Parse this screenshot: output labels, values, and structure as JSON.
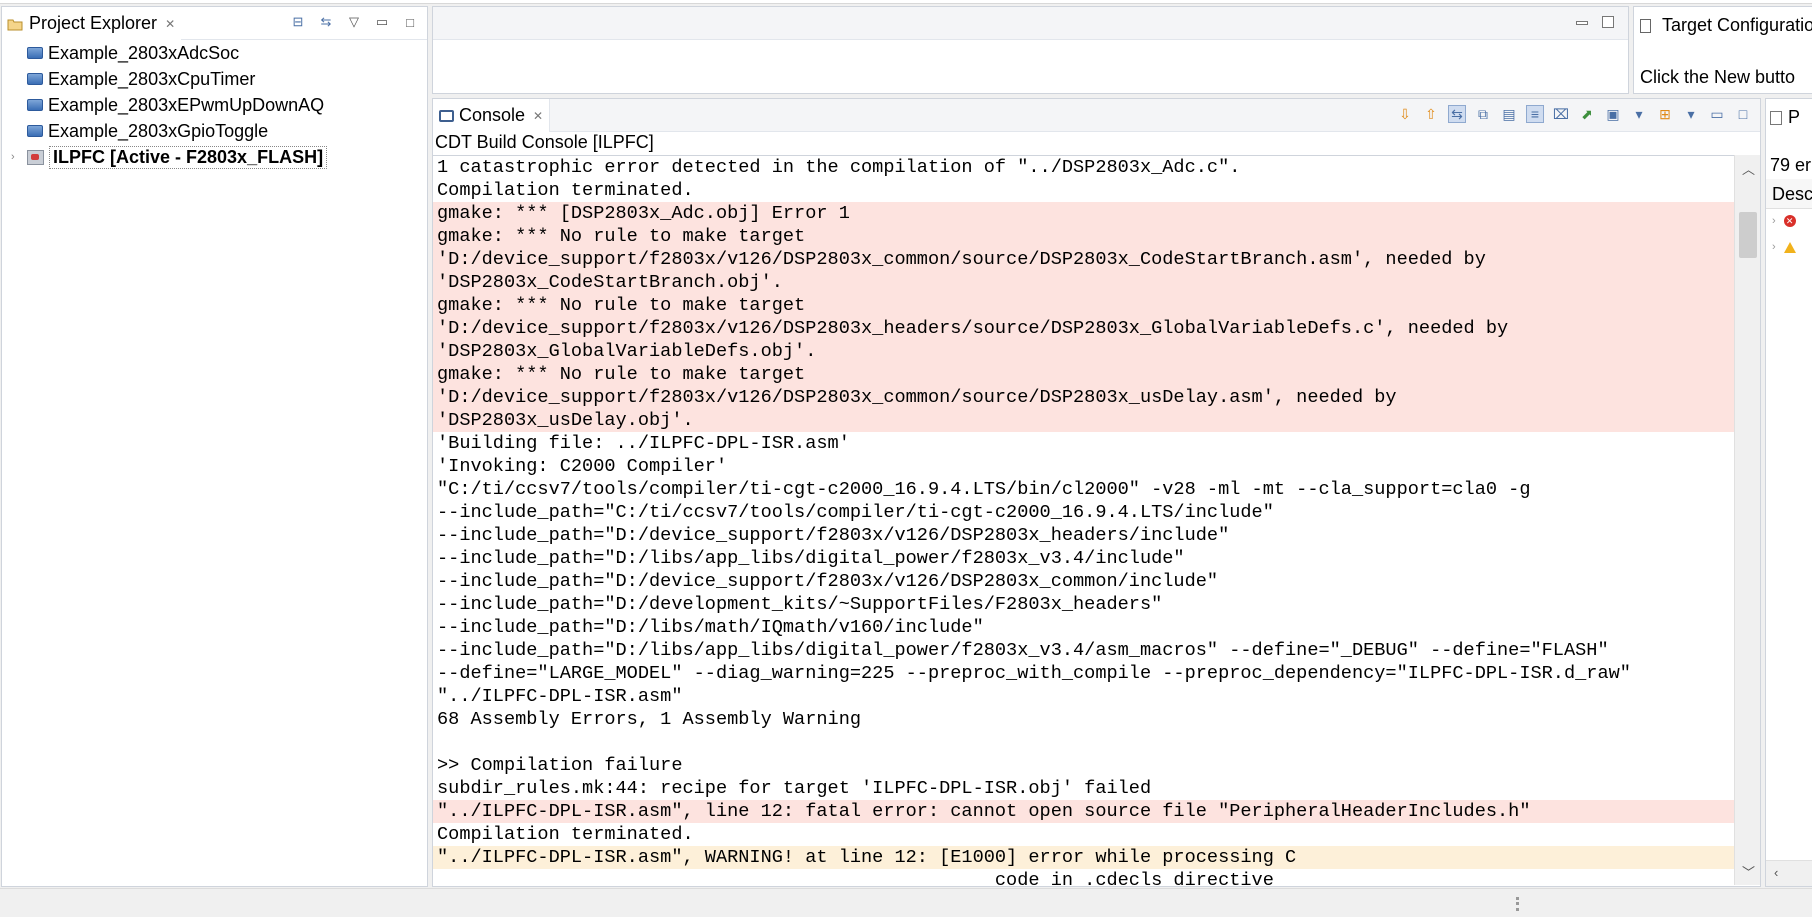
{
  "project_explorer": {
    "title": "Project Explorer",
    "items": [
      {
        "label": "Example_2803xAdcSoc"
      },
      {
        "label": "Example_2803xCpuTimer"
      },
      {
        "label": "Example_2803xEPwmUpDownAQ"
      },
      {
        "label": "Example_2803xGpioToggle"
      },
      {
        "label": "ILPFC  [Active - F2803x_FLASH]",
        "active": true
      }
    ]
  },
  "target_config": {
    "title": "Target Configuratio",
    "body": "Click the New butto"
  },
  "console": {
    "tab": "Console",
    "subtitle": "CDT Build Console [ILPFC]",
    "lines": [
      {
        "text": "1 catastrophic error detected in the compilation of \"../DSP2803x_Adc.c\".",
        "kind": "normal"
      },
      {
        "text": "Compilation terminated.",
        "kind": "normal"
      },
      {
        "text": "gmake: *** [DSP2803x_Adc.obj] Error 1",
        "kind": "err"
      },
      {
        "text": "gmake: *** No rule to make target",
        "kind": "err"
      },
      {
        "text": "'D:/device_support/f2803x/v126/DSP2803x_common/source/DSP2803x_CodeStartBranch.asm', needed by",
        "kind": "err"
      },
      {
        "text": "'DSP2803x_CodeStartBranch.obj'.",
        "kind": "err"
      },
      {
        "text": "gmake: *** No rule to make target",
        "kind": "err"
      },
      {
        "text": "'D:/device_support/f2803x/v126/DSP2803x_headers/source/DSP2803x_GlobalVariableDefs.c', needed by",
        "kind": "err"
      },
      {
        "text": "'DSP2803x_GlobalVariableDefs.obj'.",
        "kind": "err"
      },
      {
        "text": "gmake: *** No rule to make target",
        "kind": "err"
      },
      {
        "text": "'D:/device_support/f2803x/v126/DSP2803x_common/source/DSP2803x_usDelay.asm', needed by",
        "kind": "err"
      },
      {
        "text": "'DSP2803x_usDelay.obj'.",
        "kind": "err"
      },
      {
        "text": "'Building file: ../ILPFC-DPL-ISR.asm'",
        "kind": "normal"
      },
      {
        "text": "'Invoking: C2000 Compiler'",
        "kind": "normal"
      },
      {
        "text": "\"C:/ti/ccsv7/tools/compiler/ti-cgt-c2000_16.9.4.LTS/bin/cl2000\" -v28 -ml -mt --cla_support=cla0 -g",
        "kind": "normal"
      },
      {
        "text": "--include_path=\"C:/ti/ccsv7/tools/compiler/ti-cgt-c2000_16.9.4.LTS/include\"",
        "kind": "normal"
      },
      {
        "text": "--include_path=\"D:/device_support/f2803x/v126/DSP2803x_headers/include\"",
        "kind": "normal"
      },
      {
        "text": "--include_path=\"D:/libs/app_libs/digital_power/f2803x_v3.4/include\"",
        "kind": "normal"
      },
      {
        "text": "--include_path=\"D:/device_support/f2803x/v126/DSP2803x_common/include\"",
        "kind": "normal"
      },
      {
        "text": "--include_path=\"D:/development_kits/~SupportFiles/F2803x_headers\"",
        "kind": "normal"
      },
      {
        "text": "--include_path=\"D:/libs/math/IQmath/v160/include\"",
        "kind": "normal"
      },
      {
        "text": "--include_path=\"D:/libs/app_libs/digital_power/f2803x_v3.4/asm_macros\" --define=\"_DEBUG\" --define=\"FLASH\"",
        "kind": "normal"
      },
      {
        "text": "--define=\"LARGE_MODEL\" --diag_warning=225 --preproc_with_compile --preproc_dependency=\"ILPFC-DPL-ISR.d_raw\"",
        "kind": "normal"
      },
      {
        "text": "\"../ILPFC-DPL-ISR.asm\"",
        "kind": "normal"
      },
      {
        "text": "68 Assembly Errors, 1 Assembly Warning",
        "kind": "normal"
      },
      {
        "text": "",
        "kind": "normal"
      },
      {
        "text": ">> Compilation failure",
        "kind": "normal"
      },
      {
        "text": "subdir_rules.mk:44: recipe for target 'ILPFC-DPL-ISR.obj' failed",
        "kind": "normal"
      },
      {
        "text": "\"../ILPFC-DPL-ISR.asm\", line 12: fatal error: cannot open source file \"PeripheralHeaderIncludes.h\"",
        "kind": "err"
      },
      {
        "text": "Compilation terminated.",
        "kind": "normal"
      },
      {
        "text": "\"../ILPFC-DPL-ISR.asm\", WARNING! at line 12: [E1000] error while processing C",
        "kind": "warn"
      },
      {
        "text": "                                                  code in .cdecls directive",
        "kind": "normal"
      }
    ]
  },
  "problems": {
    "title": "P",
    "count": "79 er",
    "column": "Desc"
  },
  "colors": {
    "error_bg": "#fde3df",
    "warning_bg": "#fdf0d9"
  }
}
